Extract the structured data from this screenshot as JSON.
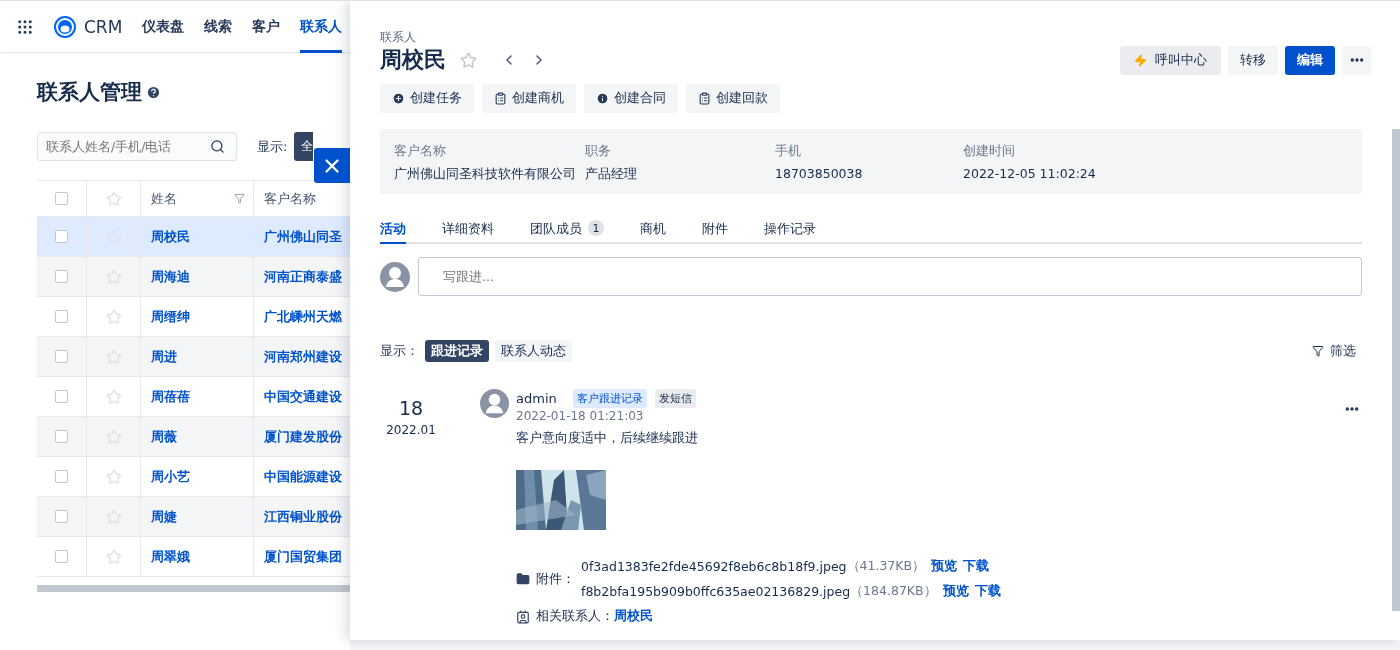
{
  "nav": {
    "app_name": "CRM",
    "items": [
      {
        "label": "仪表盘",
        "selected": false
      },
      {
        "label": "线索",
        "selected": false
      },
      {
        "label": "客户",
        "selected": false
      },
      {
        "label": "联系人",
        "selected": true
      }
    ]
  },
  "list_page": {
    "title": "联系人管理",
    "search": {
      "placeholder": "联系人姓名/手机/电话"
    },
    "filter_label": "显示:",
    "filter_button": "全",
    "table": {
      "header_checked": false,
      "columns": [
        "姓名",
        "客户名称"
      ],
      "rows": [
        {
          "name": "周校民",
          "customer": "广州佛山同圣",
          "selected": true,
          "checked": false,
          "starred": false
        },
        {
          "name": "周海迪",
          "customer": "河南正商泰盛",
          "selected": false,
          "checked": false,
          "starred": false
        },
        {
          "name": "周缙绅",
          "customer": "广北嵊州天燃",
          "selected": false,
          "checked": false,
          "starred": false
        },
        {
          "name": "周进",
          "customer": "河南郑州建设",
          "selected": false,
          "checked": false,
          "starred": false
        },
        {
          "name": "周蓓蓓",
          "customer": "中国交通建设",
          "selected": false,
          "checked": false,
          "starred": false
        },
        {
          "name": "周薇",
          "customer": "厦门建发股份",
          "selected": false,
          "checked": false,
          "starred": false
        },
        {
          "name": "周小艺",
          "customer": "中国能源建设",
          "selected": false,
          "checked": false,
          "starred": false
        },
        {
          "name": "周婕",
          "customer": "江西铜业股份",
          "selected": false,
          "checked": false,
          "starred": false
        },
        {
          "name": "周翠娥",
          "customer": "厦门国贸集团",
          "selected": false,
          "checked": false,
          "starred": false
        }
      ]
    }
  },
  "drawer": {
    "breadcrumb": "联系人",
    "title": "周校民",
    "starred": false,
    "header_buttons": [
      {
        "label": "呼叫中心",
        "kind": "call"
      },
      {
        "label": "转移",
        "kind": "default"
      },
      {
        "label": "编辑",
        "kind": "primary"
      },
      {
        "kind": "more"
      }
    ],
    "actions": [
      {
        "label": "创建任务",
        "kind": "add"
      },
      {
        "label": "创建商机",
        "kind": "doc"
      },
      {
        "label": "创建合同",
        "kind": "info"
      },
      {
        "label": "创建回款",
        "kind": "doc"
      }
    ],
    "summary": [
      {
        "label": "客户名称",
        "value": "广州佛山同圣科技软件有限公司"
      },
      {
        "label": "职务",
        "value": "产品经理"
      },
      {
        "label": "手机",
        "value": "18703850038"
      },
      {
        "label": "创建时间",
        "value": "2022-12-05 11:02:24"
      }
    ],
    "tabs": [
      {
        "label": "活动",
        "selected": true
      },
      {
        "label": "详细资料",
        "selected": false
      },
      {
        "label": "团队成员",
        "selected": false,
        "count": "1"
      },
      {
        "label": "商机",
        "selected": false
      },
      {
        "label": "附件",
        "selected": false
      },
      {
        "label": "操作记录",
        "selected": false
      }
    ],
    "comment": {
      "placeholder": "写跟进..."
    },
    "display_label": "显示：",
    "display_options": [
      {
        "label": "跟进记录",
        "selected": true
      },
      {
        "label": "联系人动态",
        "selected": false
      }
    ],
    "filter": "筛选",
    "activities": [
      {
        "day": "18",
        "month": "2022.01",
        "author": "admin",
        "tags": [
          {
            "label": "客户跟进记录",
            "kind": "primary"
          },
          {
            "label": "发短信",
            "kind": "neutral"
          }
        ],
        "time": "2022-01-18 01:21:03",
        "content": "客户意向度适中，后续继续跟进",
        "attachment_label": "附件：",
        "attachments": [
          {
            "file": "0f3ad1383fe2fde45692f8eb6c8b18f9.jpeg",
            "size": "（41.37KB）",
            "preview": "预览",
            "download": "下载"
          },
          {
            "file": "f8b2bfa195b909b0ffc635ae02136829.jpeg",
            "size": "（184.87KB）",
            "preview": "预览",
            "download": "下载"
          }
        ],
        "contact_label": "相关联系人：",
        "contact": "周校民"
      }
    ]
  }
}
